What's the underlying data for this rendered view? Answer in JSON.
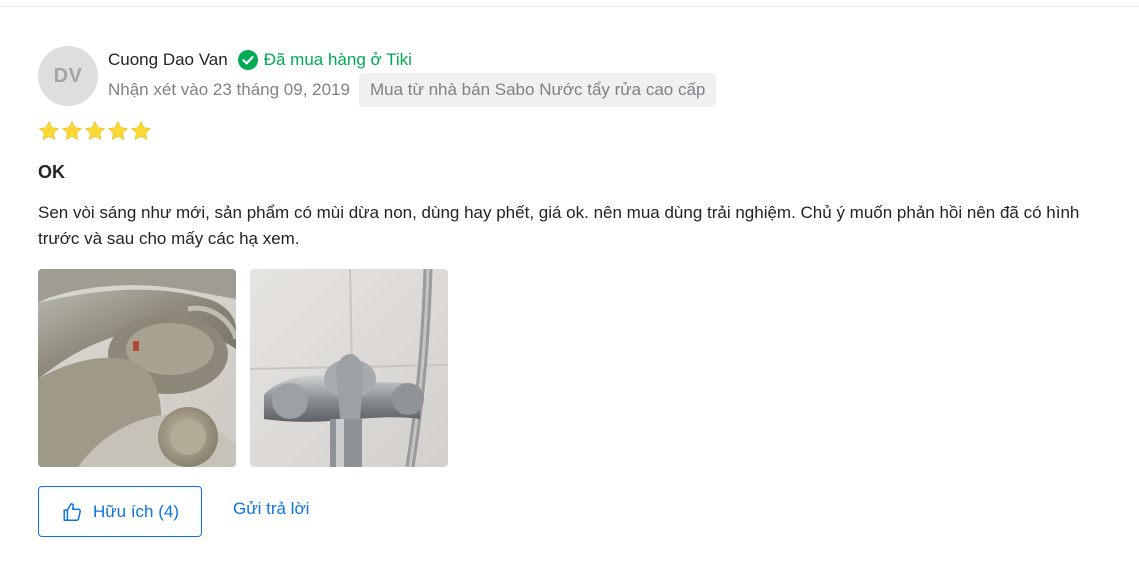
{
  "review": {
    "author": {
      "initials": "DV",
      "name": "Cuong Dao Van",
      "verified_label": "Đã mua hàng ở Tiki"
    },
    "date_text": "Nhận xét vào 23 tháng 09, 2019",
    "seller_text": "Mua từ nhà bán Sabo Nước tẩy rửa cao cấp",
    "rating": 5,
    "rating_max": 5,
    "title": "OK",
    "body": "Sen vòi sáng như mới, sản phẩm có mùi dừa non, dùng hay phết, giá ok. nên mua dùng trải nghiệm. Chủ ý muốn phản hồi nên đã có hình trước và sau cho mấy các hạ xem.",
    "photos": [
      "faucet-before-photo",
      "faucet-after-photo"
    ],
    "actions": {
      "helpful_label": "Hữu ích (4)",
      "reply_label": "Gửi trả lời"
    }
  },
  "colors": {
    "accent": "#0b74e5",
    "verified": "#00ab56",
    "star": "#fdd836",
    "muted": "#808089"
  },
  "icons": {
    "verified": "check-circle-icon",
    "star": "star-icon",
    "helpful": "thumbs-up-icon"
  }
}
